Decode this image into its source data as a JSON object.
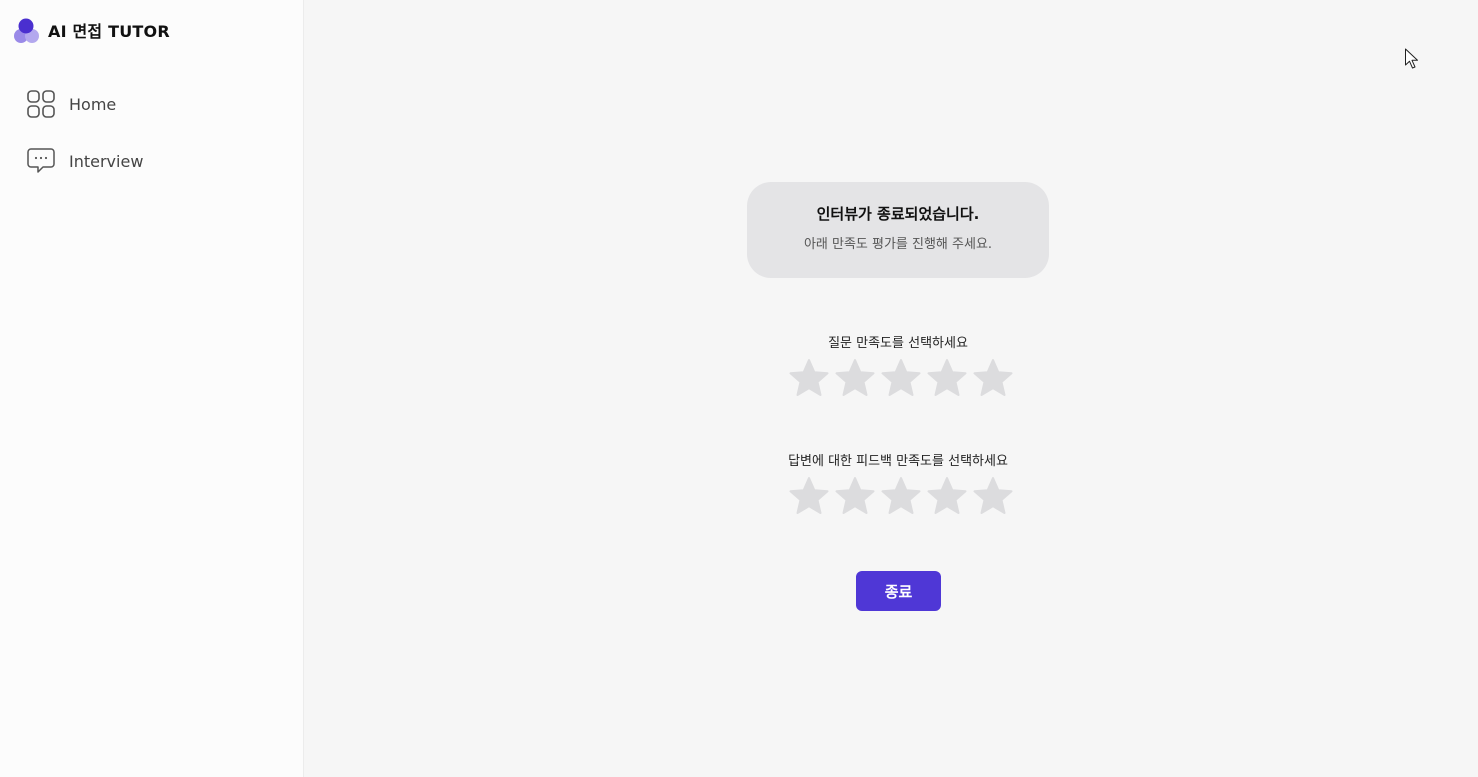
{
  "brand": {
    "title": "AI 면접 TUTOR",
    "logo_colors": [
      "#4a2fcf",
      "#9a8ae8"
    ]
  },
  "sidebar": {
    "items": [
      {
        "label": "Home",
        "icon": "grid-icon"
      },
      {
        "label": "Interview",
        "icon": "chat-bubble-icon"
      }
    ]
  },
  "completion": {
    "title": "인터뷰가 종료되었습니다.",
    "subtitle": "아래 만족도 평가를 진행해 주세요."
  },
  "ratings": [
    {
      "label": "질문 만족도를 선택하세요",
      "value": 0,
      "max": 5
    },
    {
      "label": "답변에 대한 피드백 만족도를 선택하세요",
      "value": 0,
      "max": 5
    }
  ],
  "actions": {
    "end_label": "종료"
  },
  "colors": {
    "accent": "#4f37d6",
    "star_empty": "#dcdcde",
    "card_bg": "#e4e4e6"
  }
}
